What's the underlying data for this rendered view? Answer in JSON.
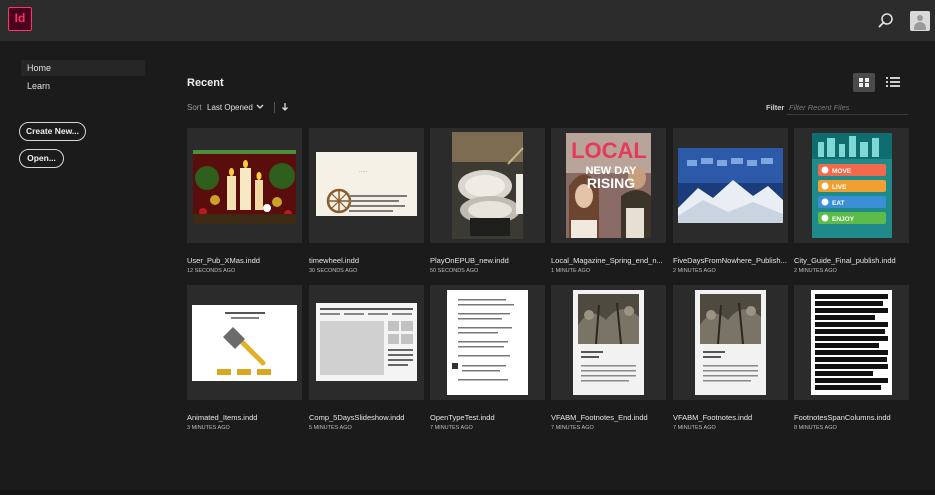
{
  "app": {
    "logo_text": "Id",
    "accent": "#ff3366"
  },
  "sidebar": {
    "nav": [
      {
        "label": "Home",
        "active": true
      },
      {
        "label": "Learn",
        "active": false
      }
    ],
    "create_label": "Create New...",
    "open_label": "Open..."
  },
  "main": {
    "title": "Recent",
    "sort_label": "Sort",
    "sort_value": "Last Opened",
    "filter_label": "Filter",
    "filter_placeholder": "Filter Recent Files"
  },
  "files": [
    {
      "name": "User_Pub_XMas.indd",
      "time": "12 SECONDS AGO"
    },
    {
      "name": "timewheel.indd",
      "time": "30 SECONDS AGO"
    },
    {
      "name": "PlayOnEPUB_new.indd",
      "time": "50 SECONDS AGO"
    },
    {
      "name": "Local_Magazine_Spring_end_n...",
      "time": "1 MINUTE AGO"
    },
    {
      "name": "FiveDaysFromNowhere_Publish...",
      "time": "2 MINUTES AGO"
    },
    {
      "name": "City_Guide_Final_publish.indd",
      "time": "2 MINUTES AGO"
    },
    {
      "name": "Animated_Items.indd",
      "time": "3 MINUTES AGO"
    },
    {
      "name": "Comp_5DaysSlideshow.indd",
      "time": "5 MINUTES AGO"
    },
    {
      "name": "OpenTypeTest.indd",
      "time": "7 MINUTES AGO"
    },
    {
      "name": "VFABM_Footnotes_End.indd",
      "time": "7 MINUTES AGO"
    },
    {
      "name": "VFABM_Footnotes.indd",
      "time": "7 MINUTES AGO"
    },
    {
      "name": "FootnotesSpanColumns.indd",
      "time": "8 MINUTES AGO"
    }
  ],
  "thumb_text": {
    "magazine_title": "LOCAL",
    "magazine_line1": "NEW DAY",
    "magazine_line2": "RISING",
    "guide_items": [
      "MOVE",
      "LIVE",
      "EAT",
      "ENJOY"
    ]
  }
}
